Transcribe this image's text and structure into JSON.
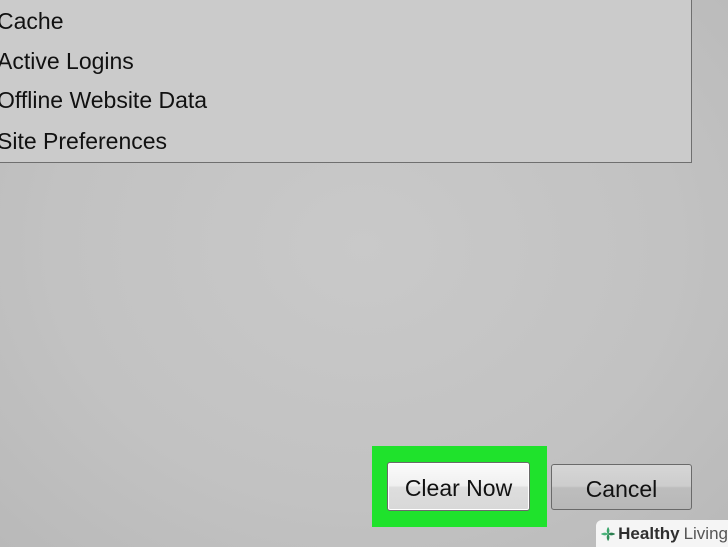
{
  "list": {
    "items": [
      "Cache",
      "Active Logins",
      "Offline Website Data",
      "Site Preferences"
    ]
  },
  "buttons": {
    "clear_now": "Clear Now",
    "cancel": "Cancel"
  },
  "colors": {
    "highlight": "#1fe22c",
    "background": "#c4c4c4"
  },
  "watermark": {
    "brand_bold": "Healthy",
    "brand_light": "Living",
    "icon": "leaf-cross-icon"
  }
}
